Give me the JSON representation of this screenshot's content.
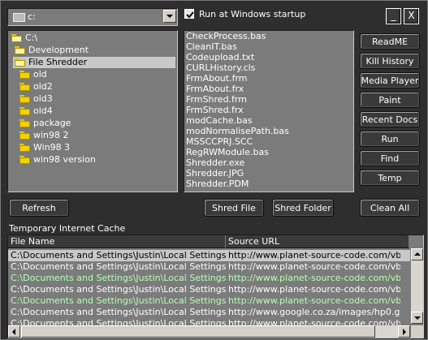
{
  "drive": {
    "value": "c:"
  },
  "startup": {
    "label": "Run at Windows startup",
    "checked": true
  },
  "title_buttons": {
    "minimize": "_",
    "close": "X"
  },
  "folders": [
    {
      "label": "C:\\",
      "state": "open"
    },
    {
      "label": "Development",
      "state": "open"
    },
    {
      "label": "File Shredder",
      "state": "open-selected"
    },
    {
      "label": "old",
      "state": "closed"
    },
    {
      "label": "old2",
      "state": "closed"
    },
    {
      "label": "old3",
      "state": "closed"
    },
    {
      "label": "old4",
      "state": "closed"
    },
    {
      "label": "package",
      "state": "closed"
    },
    {
      "label": "win98 2",
      "state": "closed"
    },
    {
      "label": "Win98 3",
      "state": "closed"
    },
    {
      "label": "win98 version",
      "state": "closed"
    }
  ],
  "files": [
    "CheckProcess.bas",
    "CleanIT.bas",
    "Codeupload.txt",
    "CURLHistory.cls",
    "FrmAbout.frm",
    "FrmAbout.frx",
    "FrmShred.frm",
    "FrmShred.frx",
    "modCache.bas",
    "modNormalisePath.bas",
    "MSSCCPRJ.SCC",
    "RegRWModule.bas",
    "Shredder.exe",
    "Shredder.JPG",
    "Shredder.PDM"
  ],
  "side_buttons": [
    "ReadME",
    "Kill History",
    "Media Player",
    "Paint",
    "Recent Docs",
    "Run",
    "Find",
    "Temp"
  ],
  "bottom_buttons": {
    "refresh": "Refresh",
    "shred_file": "Shred File",
    "shred_folder": "Shred Folder",
    "clean_all": "Clean All"
  },
  "cache": {
    "label": "Temporary Internet Cache",
    "columns": [
      "File Name",
      "Source URL"
    ],
    "rows": [
      {
        "file": "C:\\Documents and Settings\\Justin\\Local Settings\\Te...",
        "url": "http://www.planet-source-code.com/vb/scripts/",
        "color": "#000000"
      },
      {
        "file": "C:\\Documents and Settings\\Justin\\Local Settings\\Te...",
        "url": "http://www.planet-source-code.com/vb/images",
        "color": "#ffffff"
      },
      {
        "file": "C:\\Documents and Settings\\Justin\\Local Settings\\Te...",
        "url": "http://www.planet-source-code.com/vb/images",
        "color": "#b6ffb6"
      },
      {
        "file": "C:\\Documents and Settings\\Justin\\Local Settings\\Te...",
        "url": "http://www.planet-source-code.com/vb/scripts",
        "color": "#ffffff"
      },
      {
        "file": "C:\\Documents and Settings\\Justin\\Local Settings\\Te...",
        "url": "http://www.planet-source-code.com/vb/images",
        "color": "#b6ffb6"
      },
      {
        "file": "C:\\Documents and Settings\\Justin\\Local Settings\\Te...",
        "url": "http://www.google.co.za/images/hp0.gif",
        "color": "#ffffff"
      },
      {
        "file": "C:\\Documents and Settings\\Justin\\Local Settings\\Te...",
        "url": "http://www.planet-source-code.com/vb/images",
        "color": "#ffffff"
      }
    ]
  },
  "colors": {
    "background": "#2e2e2e",
    "list": "#7b7b7b",
    "selection": "#c8c8c8"
  }
}
